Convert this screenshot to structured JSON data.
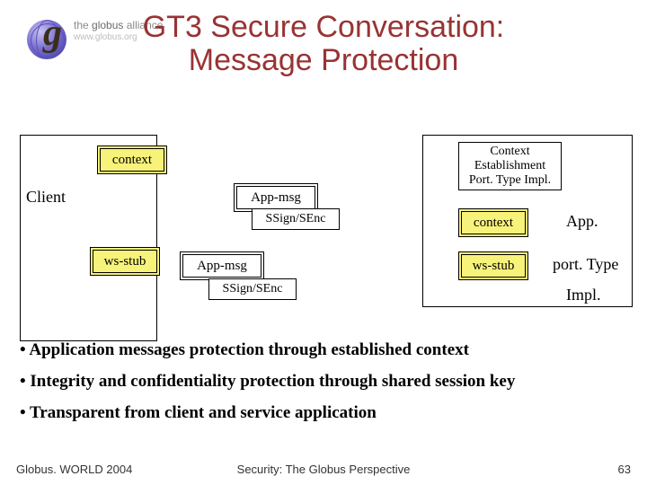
{
  "logo": {
    "brand_prefix": "the ",
    "brand_main": "globus",
    "brand_suffix": " alliance",
    "url": "www.globus.org"
  },
  "title": {
    "line1": "GT3 Secure Conversation:",
    "line2": "Message Protection"
  },
  "diagram": {
    "client_label": "Client",
    "context": "context",
    "ws_stub": "ws-stub",
    "app_msg": "App-msg",
    "ssign_senc": "SSign/SEnc",
    "context_est_impl": "Context Establishment Port. Type Impl.",
    "app": "App.",
    "porttype": "port. Type",
    "impl": "Impl."
  },
  "bullets": {
    "b1": "• Application messages protection through established context",
    "b2": "• Integrity and confidentiality protection through shared session key",
    "b3": "• Transparent from client and service application"
  },
  "footer": {
    "left": "Globus. WORLD 2004",
    "center": "Security: The Globus Perspective",
    "right": "63"
  }
}
